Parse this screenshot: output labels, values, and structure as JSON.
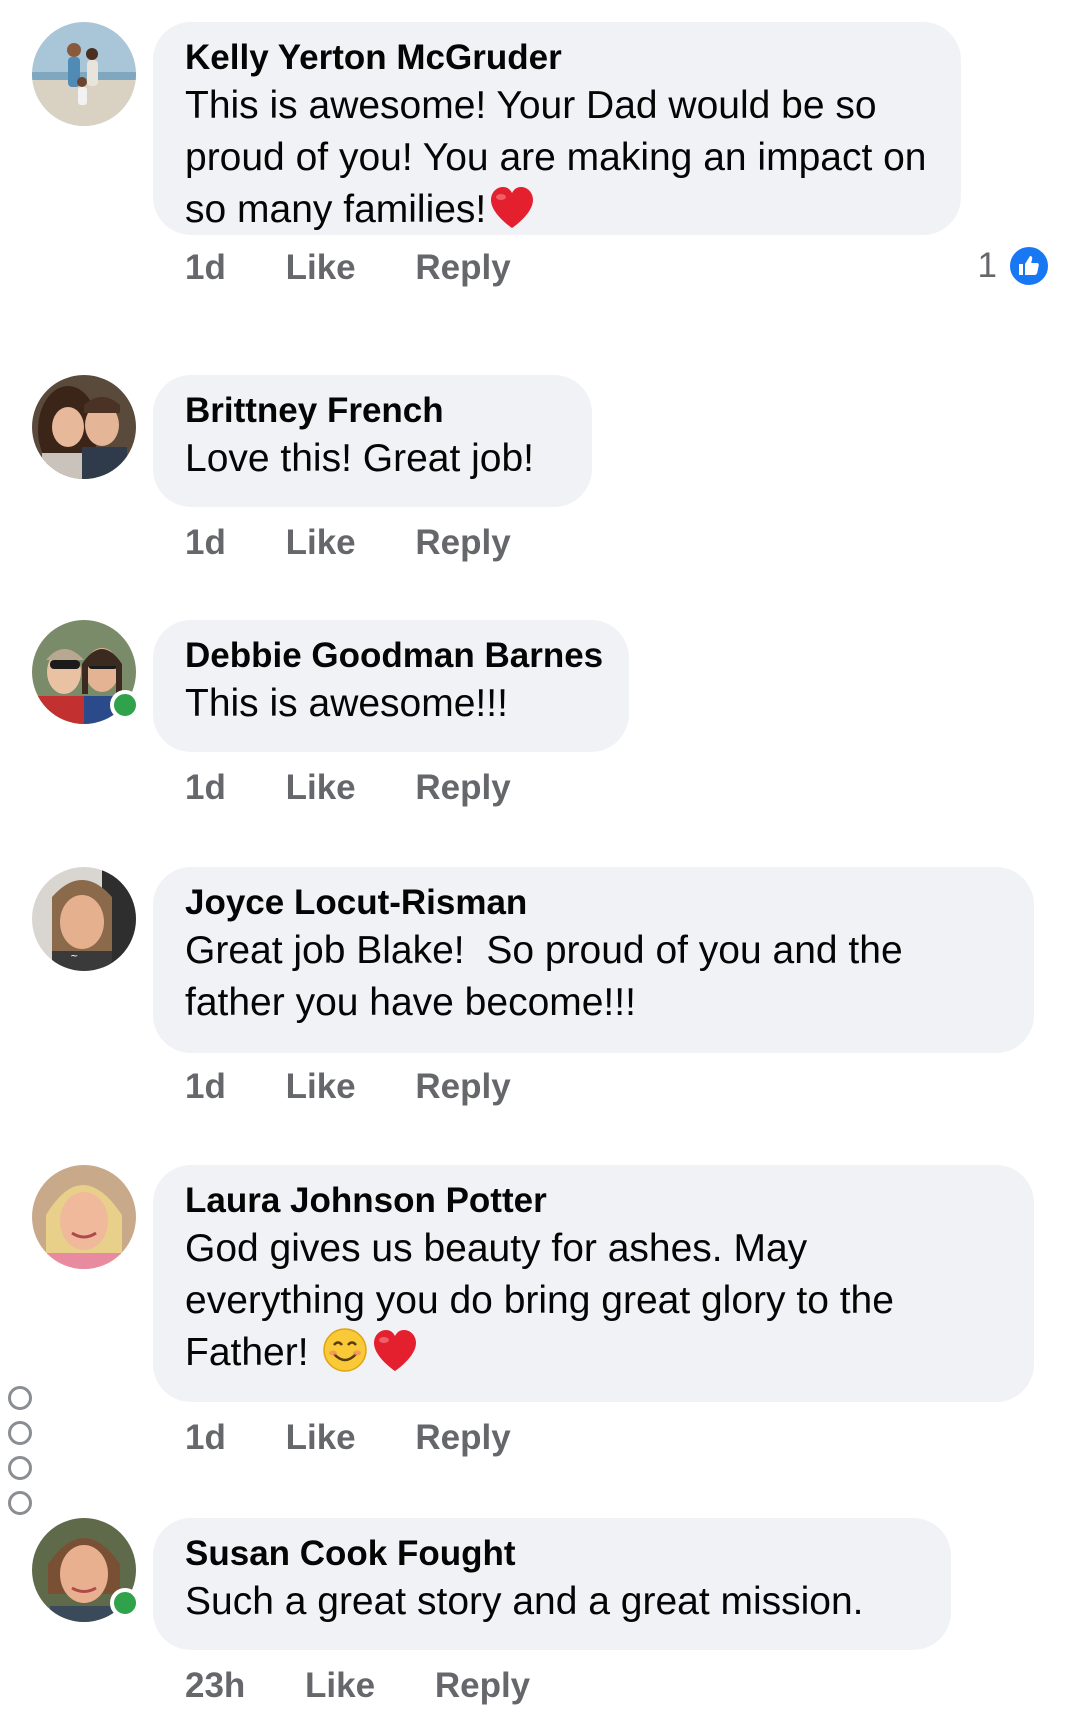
{
  "comments": [
    {
      "author": "Kelly Yerton McGruder",
      "text": "This is awesome! Your Dad would be so proud of you! You are making an impact on so many families!",
      "time": "1d",
      "like_label": "Like",
      "reply_label": "Reply",
      "reaction_count": "1",
      "emoji": [
        "heart-icon"
      ],
      "online": false
    },
    {
      "author": "Brittney French",
      "text": "Love this! Great job!",
      "time": "1d",
      "like_label": "Like",
      "reply_label": "Reply",
      "online": false
    },
    {
      "author": "Debbie Goodman Barnes",
      "text": "This is awesome!!!",
      "time": "1d",
      "like_label": "Like",
      "reply_label": "Reply",
      "online": true
    },
    {
      "author": "Joyce Locut-Risman",
      "text": "Great job Blake!  So proud of you and the father you have become!!!",
      "time": "1d",
      "like_label": "Like",
      "reply_label": "Reply",
      "online": false
    },
    {
      "author": "Laura Johnson Potter",
      "text": "God gives us beauty for ashes. May everything you do bring great glory to the Father! ",
      "time": "1d",
      "like_label": "Like",
      "reply_label": "Reply",
      "emoji": [
        "smile-icon",
        "heart-icon"
      ],
      "online": false
    },
    {
      "author": "Susan Cook Fought",
      "text": "Such a great story and a great mission.",
      "time": "23h",
      "like_label": "Like",
      "reply_label": "Reply",
      "online": true
    }
  ],
  "colors": {
    "bubble": "#f0f2f5",
    "meta_text": "#65676b",
    "like_blue": "#1877f2",
    "online_green": "#31a24c"
  }
}
